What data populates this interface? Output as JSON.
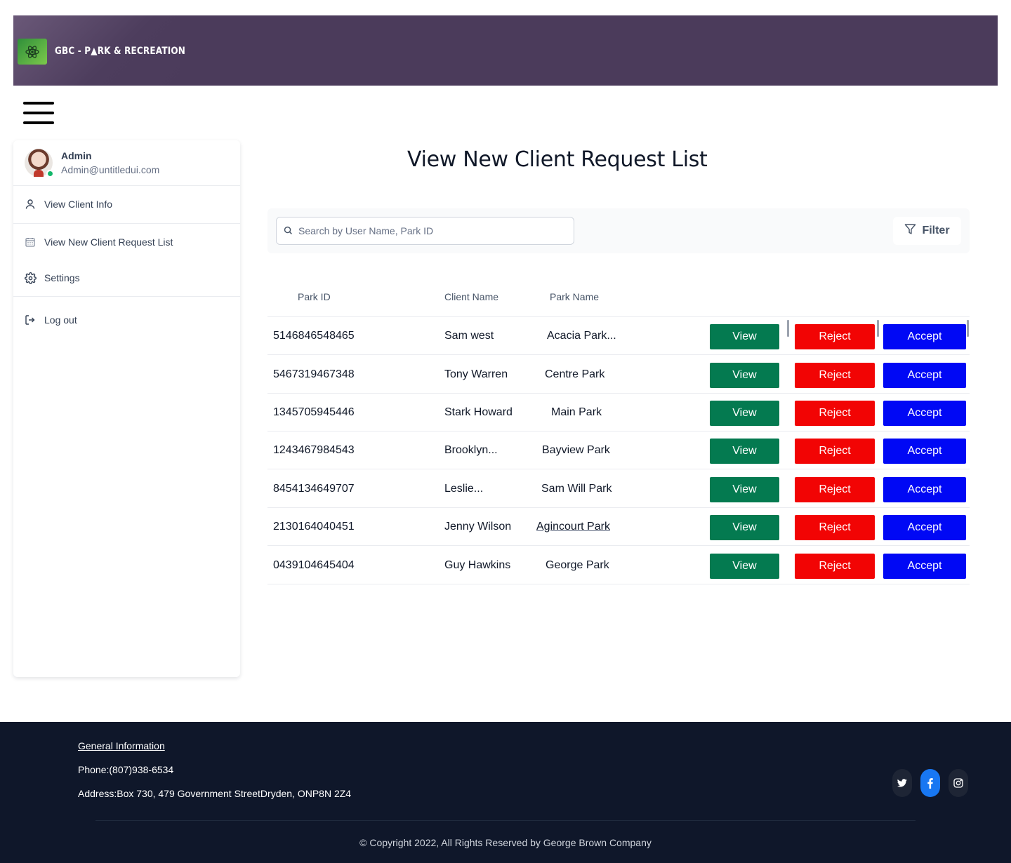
{
  "brand": {
    "logo_text": "GBC - P▲RK & RECREATION"
  },
  "user": {
    "name": "Admin",
    "email": "Admin@untitledui.com"
  },
  "nav": [
    {
      "label": "View Client Info",
      "icon": "user-icon"
    },
    {
      "label": "View New Client Request List",
      "icon": "calendar-icon"
    },
    {
      "label": "Settings",
      "icon": "gear-icon"
    },
    {
      "label": "Log out",
      "icon": "logout-icon"
    }
  ],
  "page": {
    "title": "View New Client Request List"
  },
  "search": {
    "placeholder": "Search by User Name, Park ID",
    "filter_label": "Filter"
  },
  "table": {
    "headers": [
      "Park ID",
      "Client Name",
      "Park Name"
    ],
    "rows": [
      {
        "park_id": "5146846548465",
        "client": "Sam west",
        "park": "Acacia Park..."
      },
      {
        "park_id": "5467319467348",
        "client": "Tony Warren",
        "park": "Centre Park"
      },
      {
        "park_id": "1345705945446",
        "client": "Stark Howard",
        "park": "Main Park"
      },
      {
        "park_id": "1243467984543",
        "client": "Brooklyn...",
        "park": "Bayview Park"
      },
      {
        "park_id": "8454134649707",
        "client": "Leslie...",
        "park": "Sam Will Park"
      },
      {
        "park_id": "2130164040451",
        "client": "Jenny Wilson",
        "park": "Agincourt Park"
      },
      {
        "park_id": "0439104645404",
        "client": "Guy Hawkins",
        "park": "George Park"
      }
    ],
    "actions": {
      "view": "View",
      "reject": "Reject",
      "accept": "Accept"
    }
  },
  "footer": {
    "heading": "General Information",
    "phone": "Phone:(807)938-6534",
    "address": "Address:Box 730, 479 Government StreetDryden, ONP8N 2Z4",
    "copyright": "© Copyright 2022, All Rights Reserved by George Brown Company",
    "social": [
      "twitter-icon",
      "facebook-icon",
      "instagram-icon"
    ]
  },
  "colors": {
    "banner": "#4b3b5b",
    "view": "#047a50",
    "reject": "#f20404",
    "accept": "#0008f5",
    "footer": "#0f172a"
  }
}
